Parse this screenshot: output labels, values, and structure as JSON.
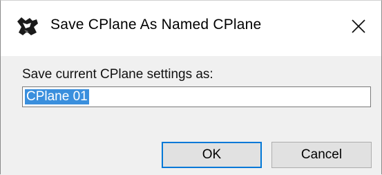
{
  "dialog": {
    "title": "Save CPlane As Named CPlane",
    "app_icon": "rhino-icon",
    "close_icon": "close-icon"
  },
  "form": {
    "prompt_label": "Save current CPlane settings as:",
    "name_value": "CPlane 01"
  },
  "buttons": {
    "ok_label": "OK",
    "cancel_label": "Cancel"
  },
  "colors": {
    "selection": "#3a8fdd",
    "default_button_border": "#0078d7"
  }
}
